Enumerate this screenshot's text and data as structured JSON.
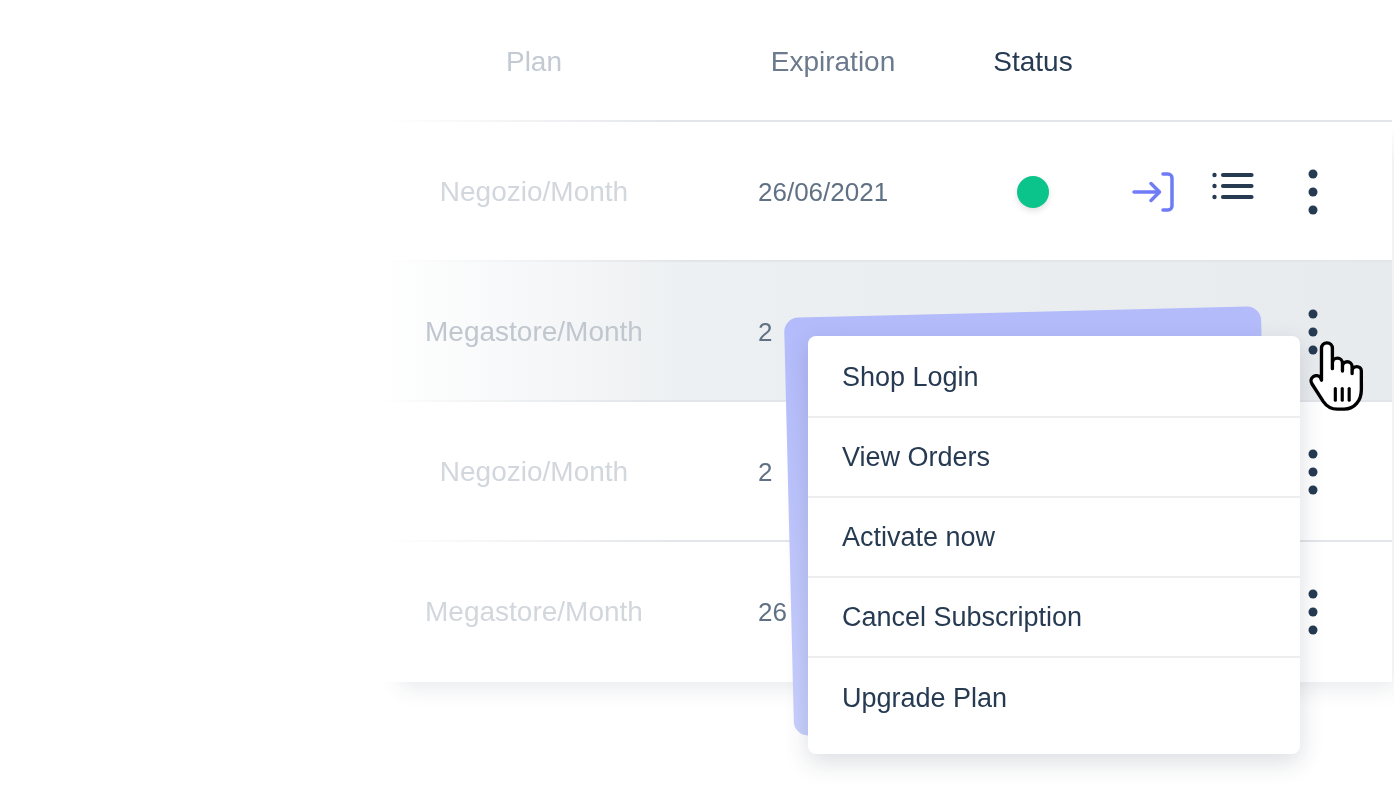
{
  "table": {
    "columns": [
      "Plan",
      "Expiration",
      "Status"
    ],
    "rows": [
      {
        "plan": "Negozio/Month",
        "expiration": "26/06/2021",
        "selected": false,
        "status_dot": {
          "color": "#0bc48b"
        },
        "quick_actions": true
      },
      {
        "plan": "Megastore/Month",
        "expiration": "2",
        "selected": true,
        "quick_actions": false
      },
      {
        "plan": "Negozio/Month",
        "expiration": "2",
        "selected": false,
        "quick_actions": false
      },
      {
        "plan": "Megastore/Month",
        "expiration": "26",
        "selected": false,
        "quick_actions": false
      }
    ]
  },
  "row_menu": {
    "items": [
      "Shop Login",
      "View Orders",
      "Activate now",
      "Cancel Subscription",
      "Upgrade Plan"
    ]
  }
}
